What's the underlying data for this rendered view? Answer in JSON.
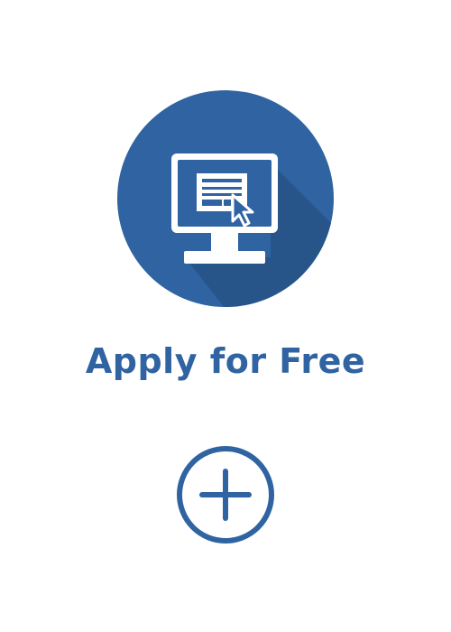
{
  "card": {
    "title": "Apply for Free",
    "icon": "computer-monitor-form-cursor-icon",
    "expand_icon": "plus-circle-icon"
  },
  "colors": {
    "brand": "#2f63a1",
    "shadow": "#285589",
    "white": "#ffffff"
  }
}
